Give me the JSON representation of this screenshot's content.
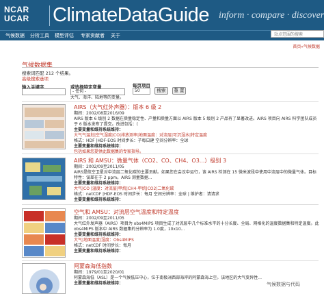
{
  "header": {
    "logo_line1": "NCAR",
    "logo_line2": "UCAR",
    "title": "ClimateDataGuide",
    "tagline": "inform · compare · discover"
  },
  "nav": {
    "items": [
      "气候数据",
      "分析工具",
      "模型评估",
      "专家贡献者",
      "关于"
    ],
    "search_placeholder": "站点范围的搜索"
  },
  "breadcrumb": "首页»气候数据",
  "section_title": "气候数据集",
  "result_count": "搜索词匹配 212 个结果。",
  "advanced_search": "高级搜索选项",
  "filters": {
    "keyword_label": "输入关键字",
    "variable_label": "或选择特定变量",
    "variable_value": "- 任何 -",
    "per_page_label": "每页项目",
    "per_page_value": "50",
    "search_button": "搜索",
    "reset_button": "重 置",
    "hint": "大气、海洋、陆地等的变量。"
  },
  "results": [
    {
      "title": "AIRS（大气红外声器）：版本 6 级 2",
      "lines": [
        {
          "text": "期间：2002/08至2016/09"
        },
        {
          "text": "AIRS 版本 6 级别 2 数据在质量稳定性、产量和质量方面以 AIRS 版本 5 级别 2 产品有了显著改进。AIRS 项目向 AIRS 科学团队成员于 6 版本发布了提交。改进包括：("
        },
        {
          "text": "主要变量和维持系统维持：",
          "bold": true
        },
        {
          "text": "大气气温划|空气湿度|CO|排放测率|地面温度：对流层|可沉湿水|特定温度",
          "link": true
        },
        {
          "text": "格式：HDF |HDF-EOS 时间步长：子每日建 空间分辨率：全球"
        },
        {
          "text": "主要变量和维持系统维持："
        },
        {
          "text": "包括如果您提供此数据集的专家指导。",
          "link": true
        }
      ],
      "thumb_colors": [
        "#f2e8e0",
        "#e0c4a8",
        "#b8c8d8",
        "#dce6ec"
      ]
    },
    {
      "title": "AIRS 和 AMSU：微量气体（CO2、CO、CH4、O3...）级别 3",
      "lines": [
        {
          "text": "期间：2002/09至2011/05"
        },
        {
          "text": "AIRS是航空卫星对中流层二氧化碳的主要贡献。如果您在会议中运行，该 AIRS 检测在 15 微米波段中使用中流层中的微量气体。目标特性：误差在于 2 ppm。AIRS 测量数据..."
        },
        {
          "text": "主要变量和维持系统维持：",
          "bold": true
        },
        {
          "text": "大气|CO |温度：对流层|甲烷|CH4-甲烷|CO2|二氧化碳",
          "link": true
        },
        {
          "text": "格式：netCDF |HDF-EOS 时间步长：每月 空间分辨率：全球 | 维护者：请请求"
        },
        {
          "text": "主要变量和维持系统维持："
        }
      ],
      "thumb_colors": [
        "#3070a8",
        "#7fb2d6",
        "#e8d88a",
        "#6aa060"
      ]
    },
    {
      "title": "空气和 AMSU：对流层空气温度和特定温度",
      "lines": [
        {
          "text": "期间：2002/09至2011/05"
        },
        {
          "text": "大气红外发声器（AIRS）项目为 obs4MIPS 项目生成了对流层中几个标准水平的十分长度、全局、网格化的温度数据集和特定温度。此 obs4MIPS 版本中 AIRS 数据集的分辨率为 1.0度，10x10..."
        },
        {
          "text": "主要变量和维持系统维持：",
          "bold": true
        },
        {
          "text": "大气|地面温度|湿度：Obs4MIPS",
          "link": true
        },
        {
          "text": "格式：netCDF 时间步长：每月"
        },
        {
          "text": "主要变量和维持系统维持："
        }
      ],
      "thumb_colors": [
        "#c83028",
        "#e88850",
        "#f0d080",
        "#5888c8"
      ]
    },
    {
      "title": "阿蒙森海低指数",
      "lines": [
        {
          "text": "期间：1979/01至2020/01"
        },
        {
          "text": "阿蒙森海低（ASL）是一个气候低压中心，位于南极洲西部海岸的阿蒙森海上空。该地区的大气变异性..."
        },
        {
          "text": "主要变量和维持系统维持：",
          "bold": true
        }
      ],
      "thumb_colors": [
        "#ffffff",
        "#c8d8ec",
        "#6890c8",
        "#f0e0d0"
      ]
    }
  ],
  "watermark": "气候数据与代码",
  "colors": {
    "header_bg": "#1e5a84",
    "accent": "#c0392b"
  }
}
